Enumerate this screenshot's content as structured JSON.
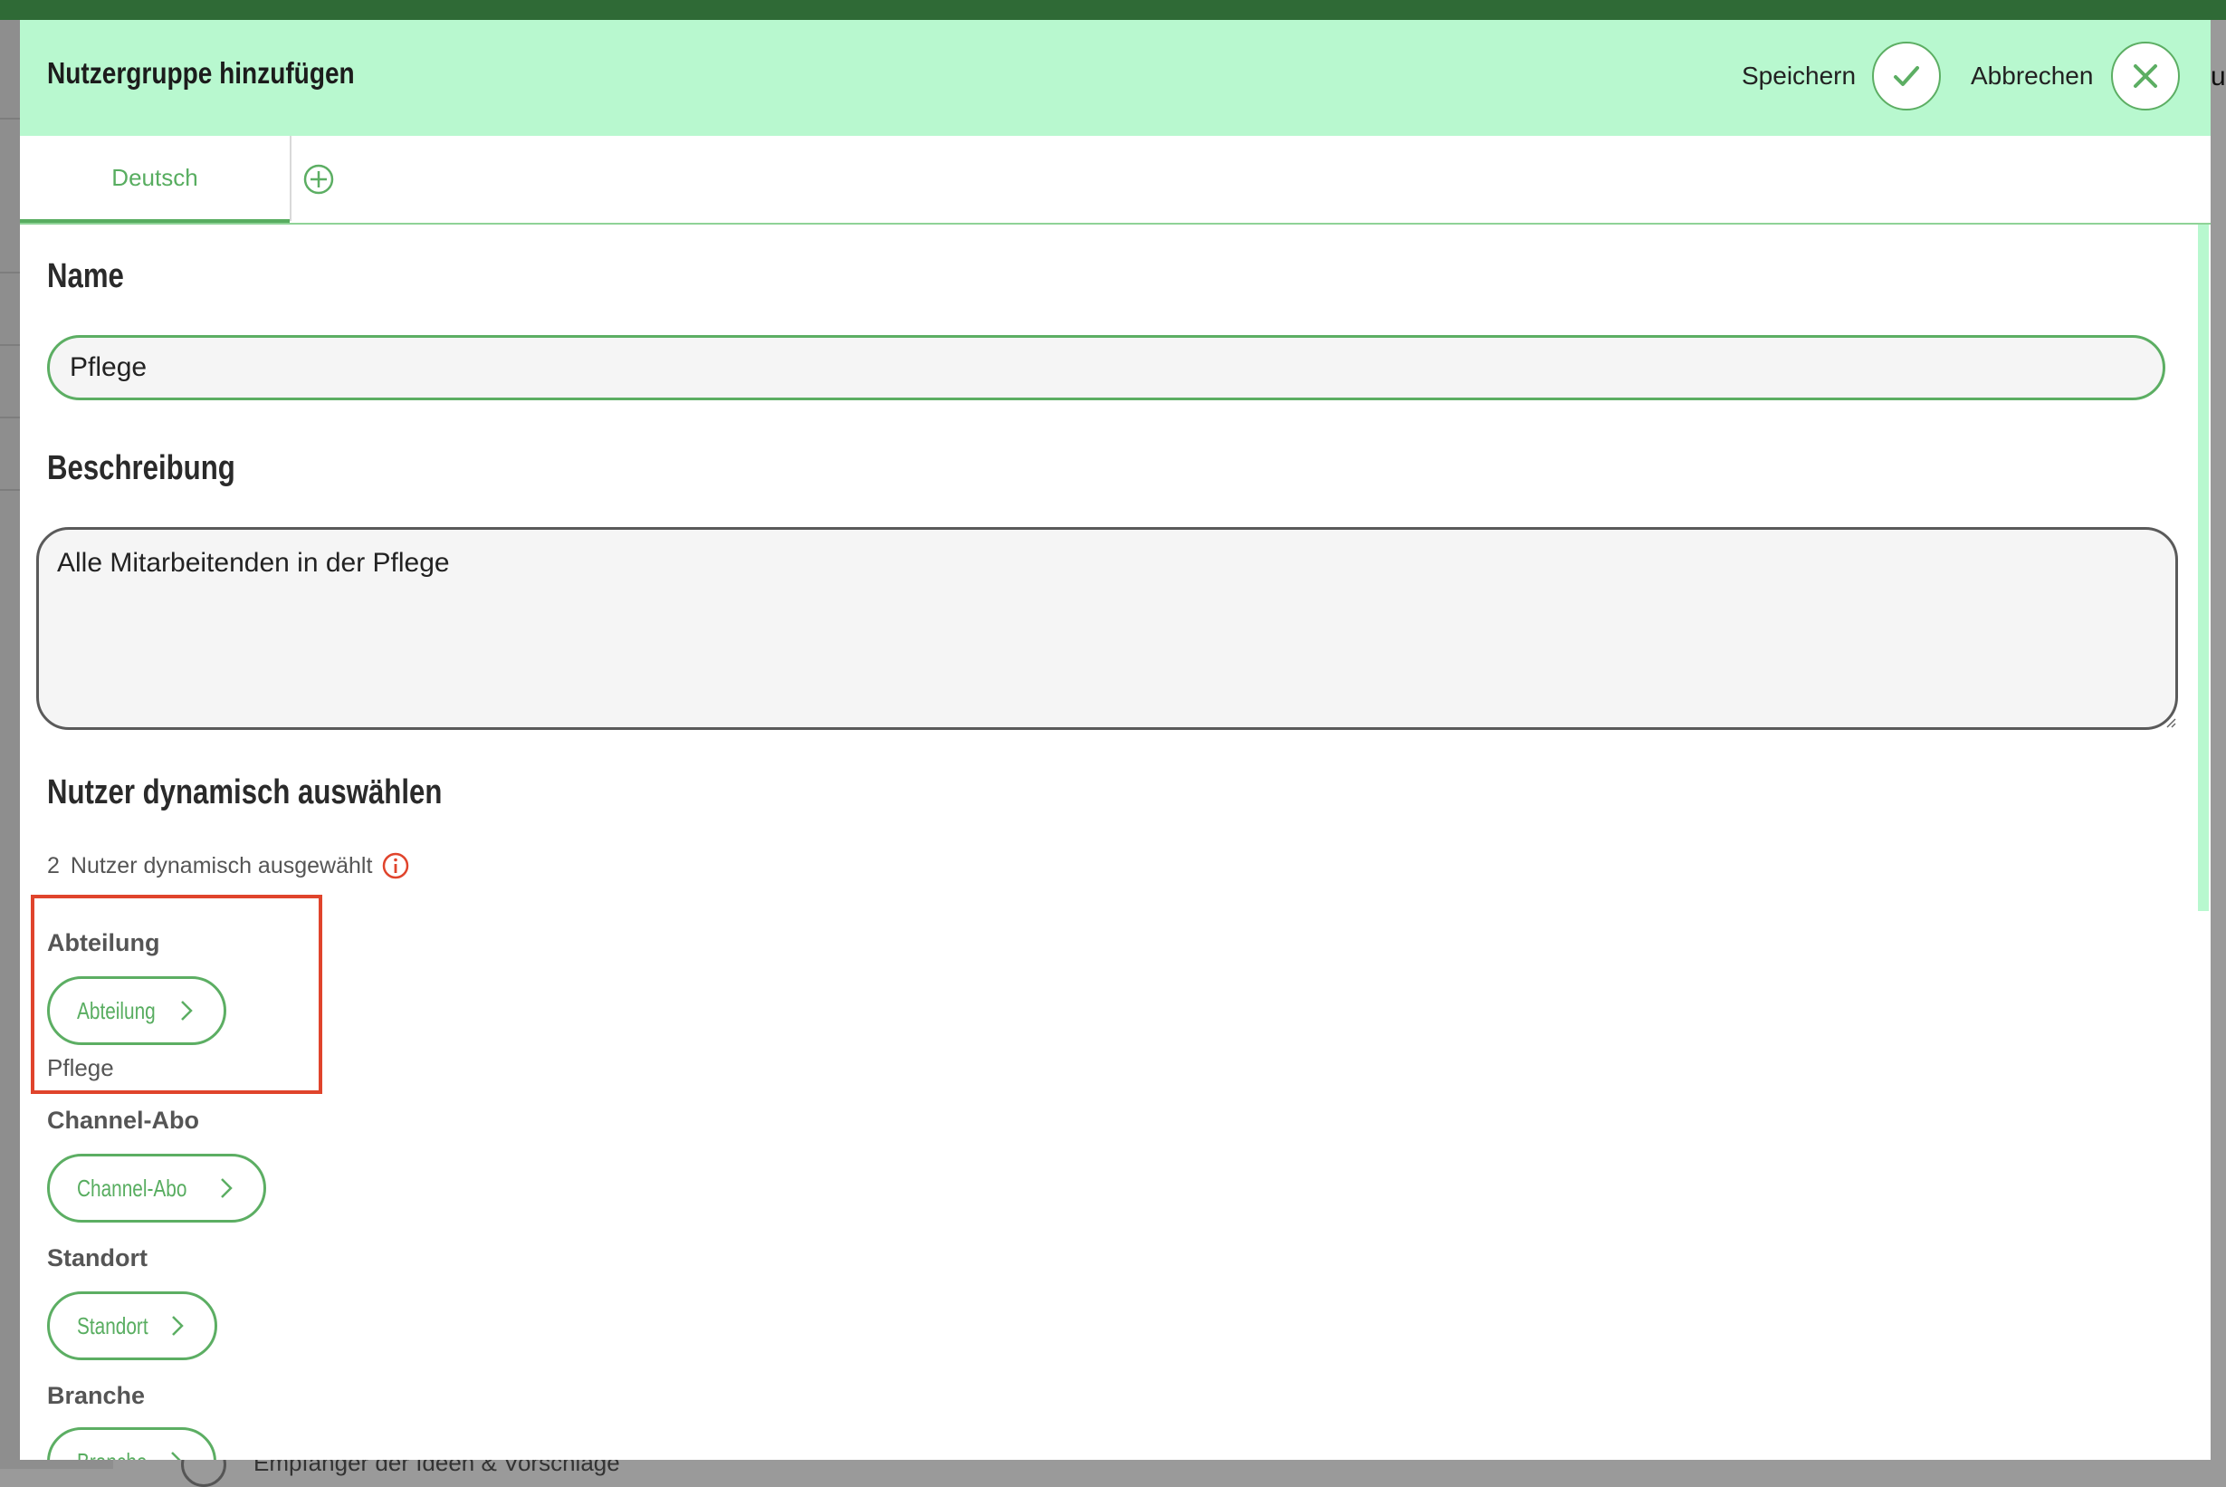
{
  "background": {
    "right_edge_text": "ue",
    "bottom_text": "Empfänger der Ideen & Vorschläge"
  },
  "modal": {
    "title": "Nutzergruppe hinzufügen",
    "save_label": "Speichern",
    "cancel_label": "Abbrechen",
    "accent_color": "#5cae63",
    "header_color": "#b8f8cf"
  },
  "tabs": [
    {
      "label": "Deutsch",
      "active": true
    }
  ],
  "form": {
    "name_heading": "Name",
    "name_value": "Pflege",
    "description_heading": "Beschreibung",
    "description_value": "Alle Mitarbeitenden in der Pflege"
  },
  "dynamic": {
    "heading": "Nutzer dynamisch auswählen",
    "count": "2",
    "count_label": "Nutzer dynamisch ausgewählt",
    "filters": [
      {
        "label": "Abteilung",
        "button": "Abteilung",
        "selected": "Pflege"
      },
      {
        "label": "Channel-Abo",
        "button": "Channel-Abo",
        "selected": ""
      },
      {
        "label": "Standort",
        "button": "Standort",
        "selected": ""
      },
      {
        "label": "Branche",
        "button": "Branche",
        "selected": ""
      }
    ]
  }
}
